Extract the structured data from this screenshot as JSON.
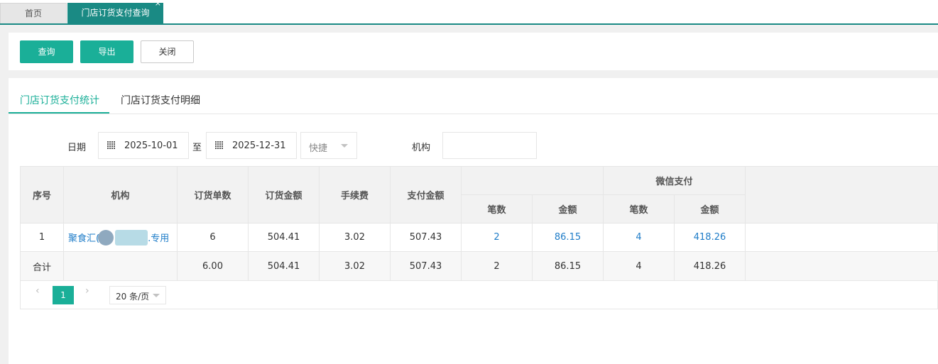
{
  "tabs": {
    "home": "首页",
    "active": "门店订货支付查询",
    "close": "×"
  },
  "toolbar": {
    "query": "查询",
    "export": "导出",
    "close": "关闭"
  },
  "subtabs": {
    "stats": "门店订货支付统计",
    "detail": "门店订货支付明细"
  },
  "filter": {
    "date_label": "日期",
    "date_from": "2025-10-01",
    "to_label": "至",
    "date_to": "2025-12-31",
    "quick": "快捷",
    "org_label": "机构",
    "org_value": ""
  },
  "table": {
    "headers": {
      "seq": "序号",
      "org": "机构",
      "order_count": "订货单数",
      "order_amount": "订货金额",
      "fee": "手续费",
      "pay_amount": "支付金额",
      "group2": "微信支付",
      "cnt": "笔数",
      "amt": "金额"
    },
    "rows": [
      {
        "seq": "1",
        "org": "聚食汇(",
        "org_suffix": ".专用",
        "order_count": "6",
        "order_amount": "504.41",
        "fee": "3.02",
        "pay_amount": "507.43",
        "g1_cnt": "2",
        "g1_amt": "86.15",
        "g2_cnt": "4",
        "g2_amt": "418.26"
      }
    ],
    "total": {
      "label": "合计",
      "order_count": "6.00",
      "order_amount": "504.41",
      "fee": "3.02",
      "pay_amount": "507.43",
      "g1_cnt": "2",
      "g1_amt": "86.15",
      "g2_cnt": "4",
      "g2_amt": "418.26"
    }
  },
  "pager": {
    "prev": "‹",
    "page": "1",
    "next": "›",
    "page_size": "20 条/页"
  },
  "colors": {
    "accent": "#1aaf98",
    "tab_active": "#1a8a84",
    "link": "#1e7cc8"
  }
}
